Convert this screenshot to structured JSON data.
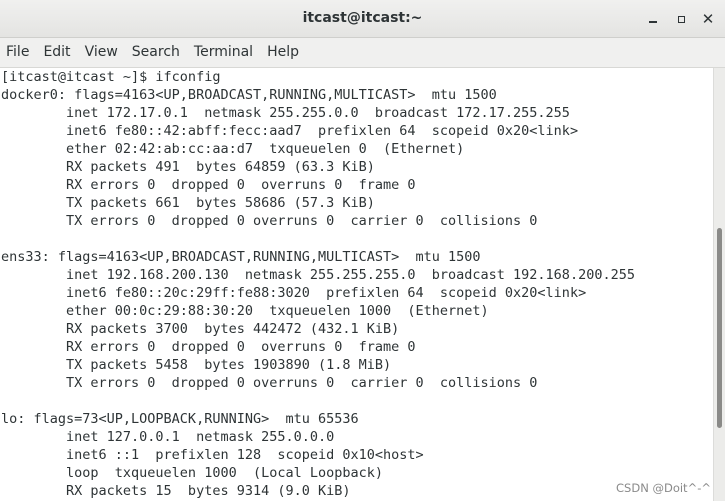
{
  "window": {
    "title": "itcast@itcast:~",
    "controls": {
      "minimize_icon": "minimize-icon",
      "maximize_icon": "maximize-icon",
      "close_icon": "close-icon"
    }
  },
  "menu": [
    "File",
    "Edit",
    "View",
    "Search",
    "Terminal",
    "Help"
  ],
  "terminal": {
    "lines": [
      "[itcast@itcast ~]$ ifconfig",
      "docker0: flags=4163<UP,BROADCAST,RUNNING,MULTICAST>  mtu 1500",
      "        inet 172.17.0.1  netmask 255.255.0.0  broadcast 172.17.255.255",
      "        inet6 fe80::42:abff:fecc:aad7  prefixlen 64  scopeid 0x20<link>",
      "        ether 02:42:ab:cc:aa:d7  txqueuelen 0  (Ethernet)",
      "        RX packets 491  bytes 64859 (63.3 KiB)",
      "        RX errors 0  dropped 0  overruns 0  frame 0",
      "        TX packets 661  bytes 58686 (57.3 KiB)",
      "        TX errors 0  dropped 0 overruns 0  carrier 0  collisions 0",
      "",
      "ens33: flags=4163<UP,BROADCAST,RUNNING,MULTICAST>  mtu 1500",
      "        inet 192.168.200.130  netmask 255.255.255.0  broadcast 192.168.200.255",
      "        inet6 fe80::20c:29ff:fe88:3020  prefixlen 64  scopeid 0x20<link>",
      "        ether 00:0c:29:88:30:20  txqueuelen 1000  (Ethernet)",
      "        RX packets 3700  bytes 442472 (432.1 KiB)",
      "        RX errors 0  dropped 0  overruns 0  frame 0",
      "        TX packets 5458  bytes 1903890 (1.8 MiB)",
      "        TX errors 0  dropped 0 overruns 0  carrier 0  collisions 0",
      "",
      "lo: flags=73<UP,LOOPBACK,RUNNING>  mtu 65536",
      "        inet 127.0.0.1  netmask 255.0.0.0",
      "        inet6 ::1  prefixlen 128  scopeid 0x10<host>",
      "        loop  txqueuelen 1000  (Local Loopback)",
      "        RX packets 15  bytes 9314 (9.0 KiB)"
    ]
  },
  "watermark": "CSDN @Doit^-^"
}
